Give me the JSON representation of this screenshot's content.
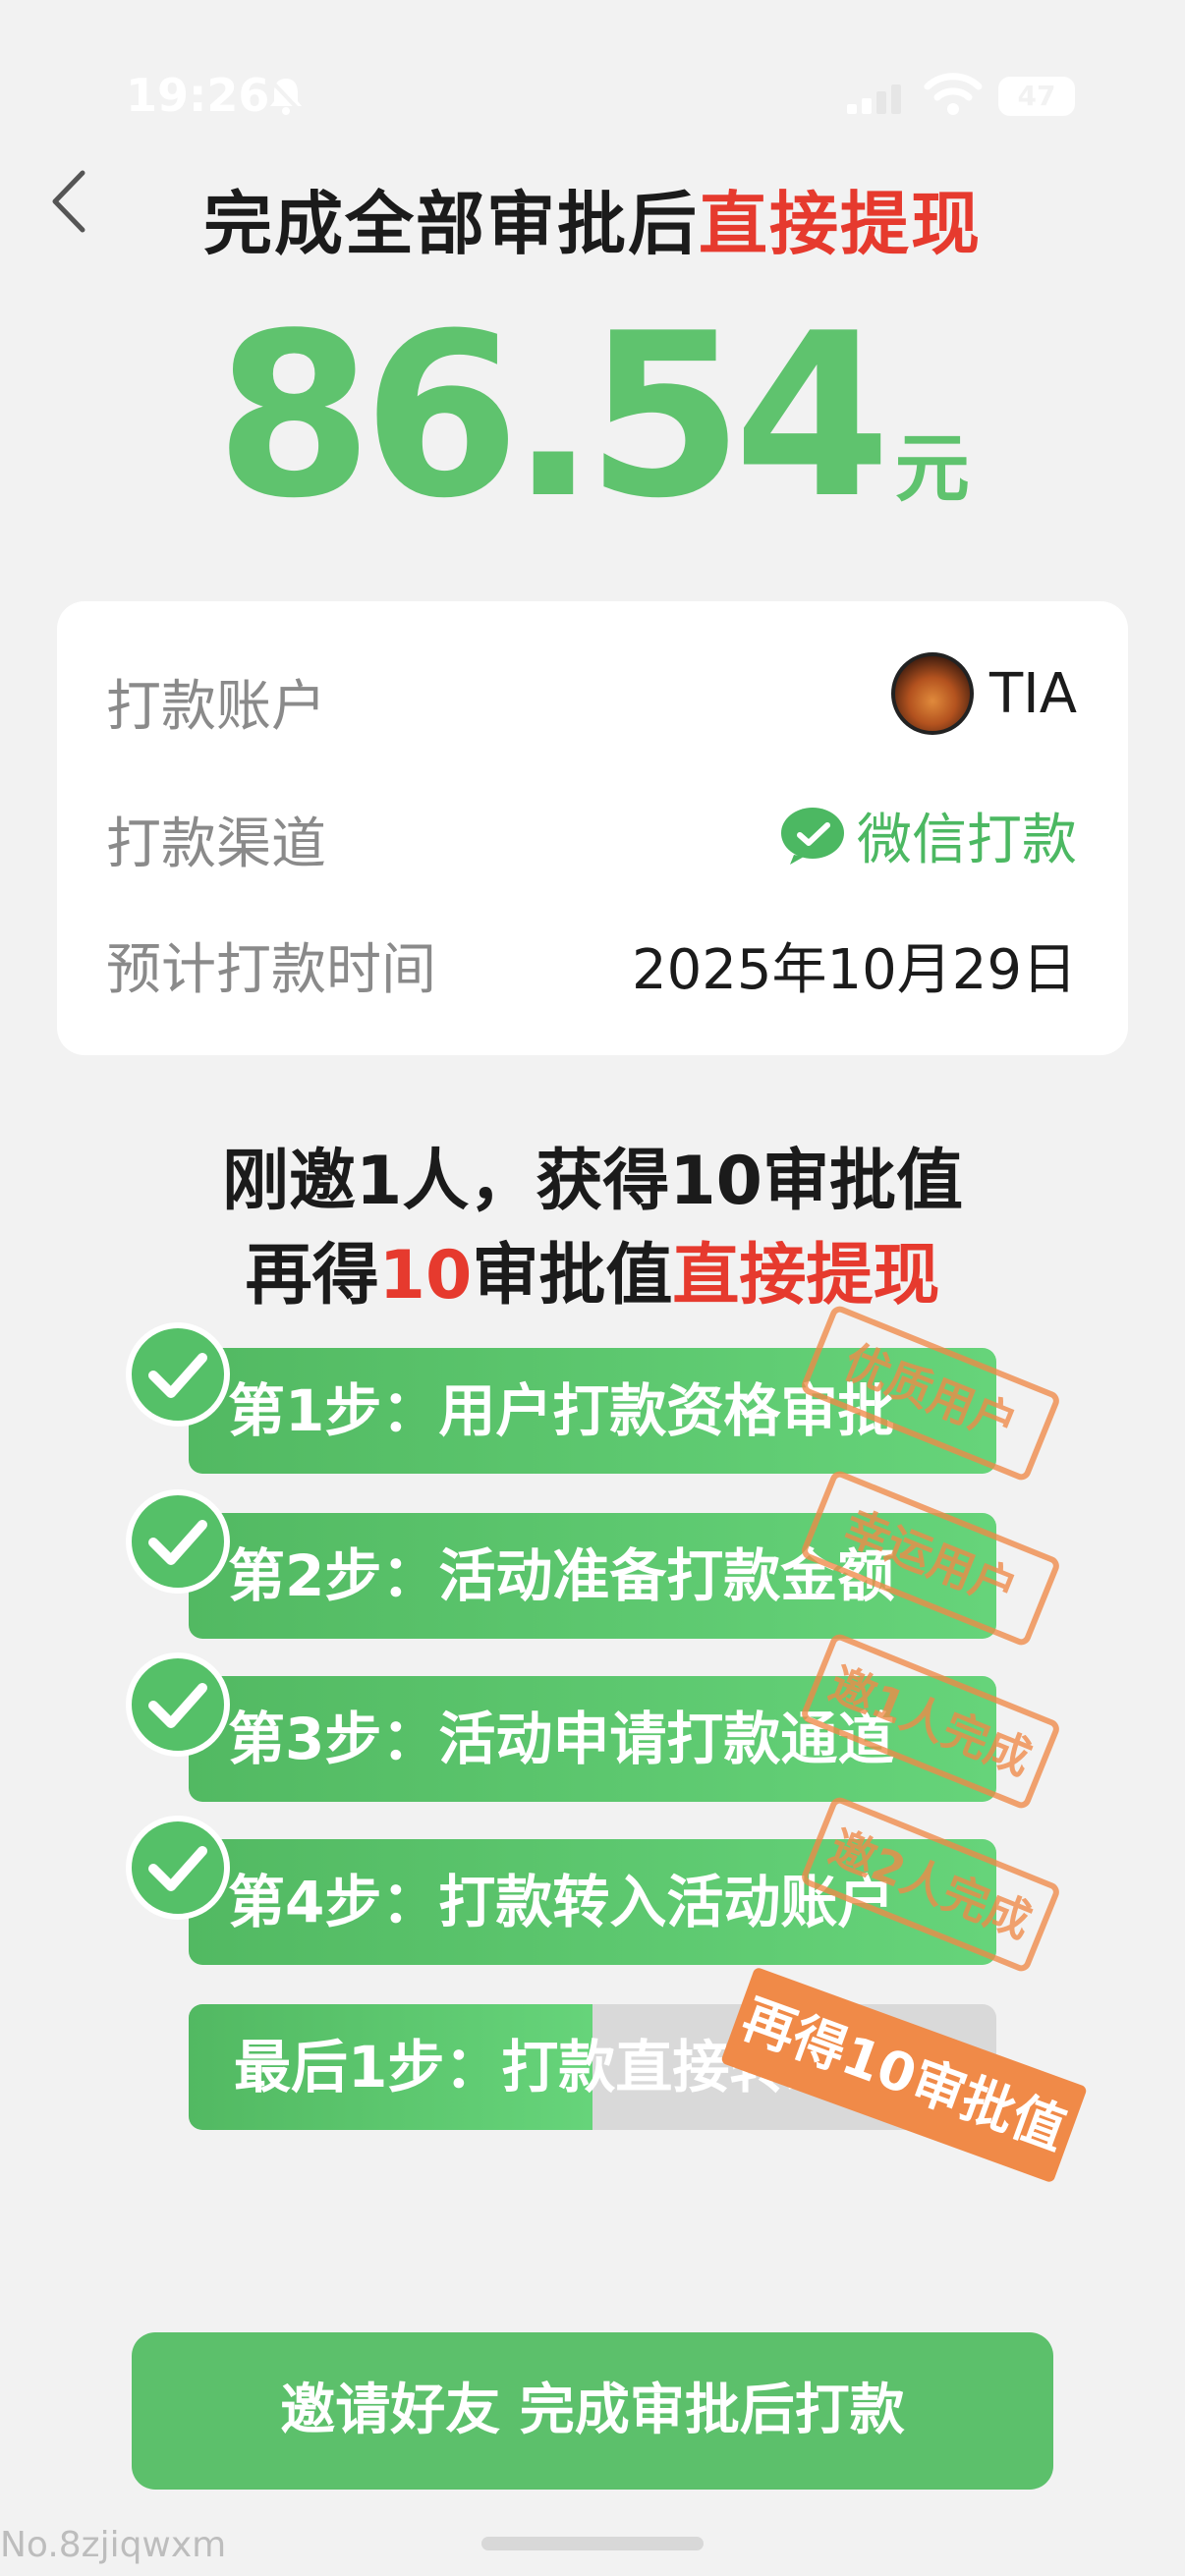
{
  "status_bar": {
    "time": "19:26",
    "battery": "47"
  },
  "header": {
    "title_part1": "完成全部审批后",
    "title_part2": "直接提现"
  },
  "amount": {
    "value": "86.54",
    "unit": "元"
  },
  "payout_info": {
    "account_label": "打款账户",
    "account_name": "TIA",
    "channel_label": "打款渠道",
    "channel_value": "微信打款",
    "time_label": "预计打款时间",
    "time_value": "2025年10月29日"
  },
  "promo": {
    "line1": "刚邀1人，获得10审批值",
    "line2_part1": "再得",
    "line2_part2": "10",
    "line2_part3": "审批值",
    "line2_part4": "直接提现"
  },
  "steps": [
    {
      "label": "第1步：用户打款资格审批",
      "stamp": "优质用户",
      "done": true
    },
    {
      "label": "第2步：活动准备打款金额",
      "stamp": "幸运用户",
      "done": true
    },
    {
      "label": "第3步：活动申请打款通道",
      "stamp": "邀1人完成",
      "done": true
    },
    {
      "label": "第4步：打款转入活动账户",
      "stamp": "邀2人完成",
      "done": true
    }
  ],
  "last_step": {
    "label": "最后1步：打款直接转给你",
    "progress": 0.5,
    "badge": "再得10审批值"
  },
  "cta": {
    "label": "邀请好友 完成审批后打款"
  },
  "watermark": "No.8zjiqwxm",
  "colors": {
    "accent_green": "#5fc36e",
    "highlight_red": "#e63a2e",
    "stamp_orange": "#f08a48"
  }
}
